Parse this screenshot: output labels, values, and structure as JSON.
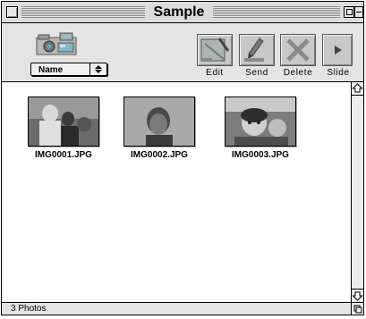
{
  "window": {
    "title": "Sample"
  },
  "toolbar": {
    "sort": {
      "selected": "Name"
    },
    "buttons": [
      {
        "label": "Edit",
        "icon": "edit-icon"
      },
      {
        "label": "Send",
        "icon": "send-icon"
      },
      {
        "label": "Delete",
        "icon": "delete-icon"
      },
      {
        "label": "Slide",
        "icon": "slideshow-play-icon"
      }
    ]
  },
  "photos": [
    {
      "filename": "IMG0001.JPG"
    },
    {
      "filename": "IMG0002.JPG"
    },
    {
      "filename": "IMG0003.JPG"
    }
  ],
  "status": {
    "text": "3 Photos"
  },
  "colors": {
    "window_chrome": "#dcdcdc",
    "toolbar_bg": "#e4e4e4",
    "button_bg": "#c8c8c8"
  }
}
